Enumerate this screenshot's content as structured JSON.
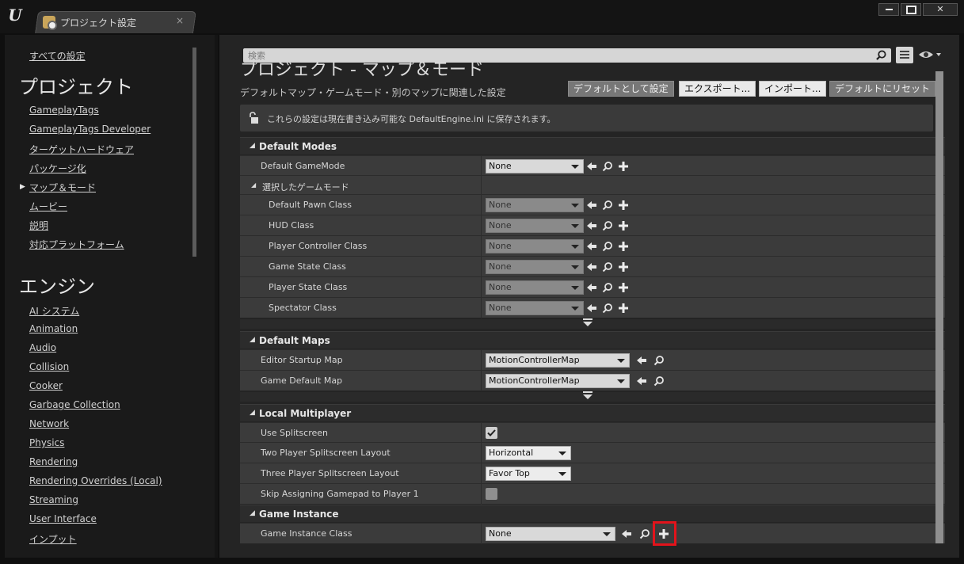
{
  "window": {
    "tab_label": "プロジェクト設定",
    "close_glyph": "×",
    "controls": {
      "minimize": "",
      "maximize": "",
      "close": "✕"
    }
  },
  "sidebar": {
    "all_settings": "すべての設定",
    "project_header": "プロジェクト",
    "project_items": [
      "GameplayTags",
      "GameplayTags Developer",
      "ターゲットハードウェア",
      "パッケージ化",
      "マップ＆モード",
      "ムービー",
      "説明",
      "対応プラットフォーム"
    ],
    "selected_marker": "▶",
    "engine_header": "エンジン",
    "engine_items": [
      "AI システム",
      "Animation",
      "Audio",
      "Collision",
      "Cooker",
      "Garbage Collection",
      "Network",
      "Physics",
      "Rendering",
      "Rendering Overrides (Local)",
      "Streaming",
      "User Interface",
      "インプット"
    ]
  },
  "toolbar": {
    "search_placeholder": "検索"
  },
  "page": {
    "title": "プロジェクト - マップ＆モード",
    "description": "デフォルトマップ・ゲームモード・別のマップに関連した設定",
    "buttons": {
      "set_default": "デフォルトとして設定",
      "export": "エクスポート...",
      "import": "インポート...",
      "reset": "デフォルトにリセット"
    },
    "notice": "これらの設定は現在書き込み可能な DefaultEngine.ini に保存されます。"
  },
  "sections": {
    "default_modes": {
      "title": "Default Modes",
      "default_gamemode": {
        "label": "Default GameMode",
        "value": "None"
      },
      "selected_gamemode": "選択したゲームモード",
      "pawn": {
        "label": "Default Pawn Class",
        "value": "None"
      },
      "hud": {
        "label": "HUD Class",
        "value": "None"
      },
      "controller": {
        "label": "Player Controller Class",
        "value": "None"
      },
      "game_state": {
        "label": "Game State Class",
        "value": "None"
      },
      "player_state": {
        "label": "Player State Class",
        "value": "None"
      },
      "spectator": {
        "label": "Spectator Class",
        "value": "None"
      }
    },
    "default_maps": {
      "title": "Default Maps",
      "editor_startup": {
        "label": "Editor Startup Map",
        "value": "MotionControllerMap"
      },
      "game_default": {
        "label": "Game Default Map",
        "value": "MotionControllerMap"
      }
    },
    "local_multiplayer": {
      "title": "Local Multiplayer",
      "use_splitscreen": {
        "label": "Use Splitscreen",
        "checked": true
      },
      "two_player": {
        "label": "Two Player Splitscreen Layout",
        "value": "Horizontal"
      },
      "three_player": {
        "label": "Three Player Splitscreen Layout",
        "value": "Favor Top"
      },
      "skip_gamepad": {
        "label": "Skip Assigning Gamepad to Player 1",
        "checked": false
      }
    },
    "game_instance": {
      "title": "Game Instance",
      "class": {
        "label": "Game Instance Class",
        "value": "None"
      }
    }
  },
  "colors": {
    "highlight": "#e3131b",
    "panel": "#242424",
    "row": "#3b3b3b"
  }
}
